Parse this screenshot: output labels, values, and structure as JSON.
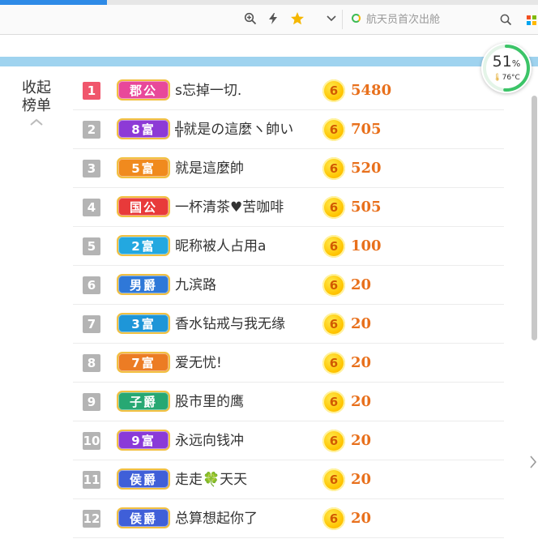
{
  "browser": {
    "search": {
      "value": "",
      "placeholder": "航天员首次出舱"
    },
    "icons": [
      "zoom-icon",
      "bolt-icon",
      "star-icon",
      "chevron-down-icon",
      "search-icon",
      "apps-icon"
    ]
  },
  "widget": {
    "usage_value": "51",
    "usage_unit": "%",
    "temp": "76°C",
    "usage_fraction": 0.51
  },
  "collapse": {
    "label": "收起榜单"
  },
  "ranking": [
    {
      "rank": "1",
      "title": "郡公",
      "badge_color": "#e8489a",
      "name": "s忘掉一切.",
      "coin": "6",
      "score": "5480"
    },
    {
      "rank": "2",
      "title": "8富",
      "badge_color": "#8d3ad6",
      "name": "╬就是の這麼ヽ帥い",
      "coin": "6",
      "score": "705"
    },
    {
      "rank": "3",
      "title": "5富",
      "badge_color": "#f08a1e",
      "name": "就是這麼帥",
      "coin": "6",
      "score": "520"
    },
    {
      "rank": "4",
      "title": "国公",
      "badge_color": "#e83a3a",
      "name": "一杯清茶♥苦咖啡",
      "coin": "6",
      "score": "505"
    },
    {
      "rank": "5",
      "title": "2富",
      "badge_color": "#23a8e0",
      "name": "昵称被人占用a",
      "coin": "6",
      "score": "100"
    },
    {
      "rank": "6",
      "title": "男爵",
      "badge_color": "#2f78d8",
      "name": "九滨路",
      "coin": "6",
      "score": "20"
    },
    {
      "rank": "7",
      "title": "3富",
      "badge_color": "#1e96d8",
      "name": "香水钻戒与我无缘",
      "coin": "6",
      "score": "20"
    },
    {
      "rank": "8",
      "title": "7富",
      "badge_color": "#ec7c24",
      "name": "爱无忧!",
      "coin": "6",
      "score": "20"
    },
    {
      "rank": "9",
      "title": "子爵",
      "badge_color": "#27a873",
      "name": "股市里的鹰",
      "coin": "6",
      "score": "20"
    },
    {
      "rank": "10",
      "title": "9富",
      "badge_color": "#8a3ad8",
      "name": "永远向钱冲",
      "coin": "6",
      "score": "20"
    },
    {
      "rank": "11",
      "title": "侯爵",
      "badge_color": "#3f5fd8",
      "name": "走走🍀天天",
      "coin": "6",
      "score": "20"
    },
    {
      "rank": "12",
      "title": "侯爵",
      "badge_color": "#3f5fd8",
      "name": "总算想起你了",
      "coin": "6",
      "score": "20"
    }
  ]
}
